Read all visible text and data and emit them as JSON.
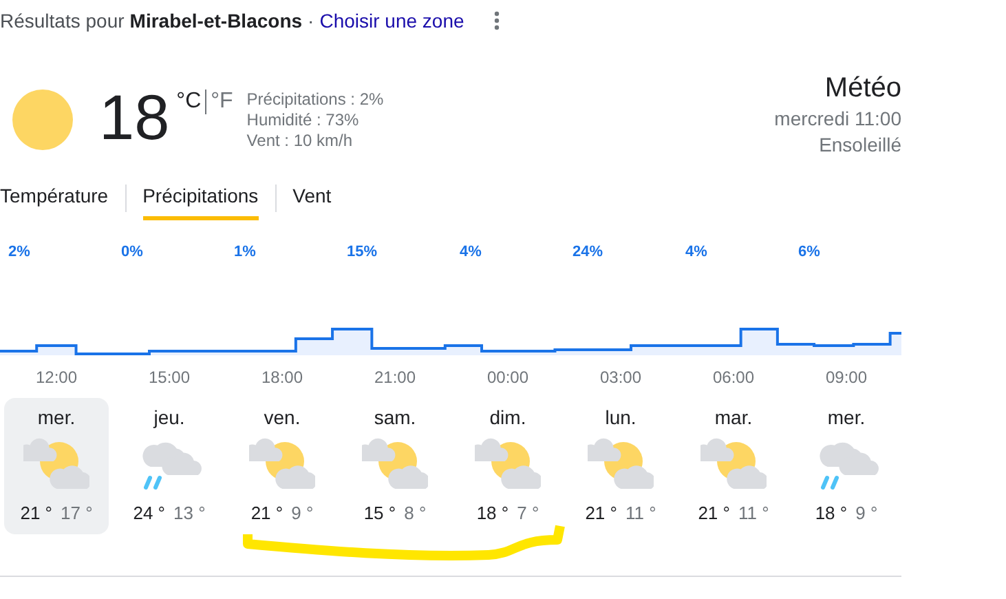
{
  "header": {
    "prefix": "Résultats pour",
    "location": "Mirabel-et-Blacons",
    "separator": "·",
    "change_link": "Choisir une zone"
  },
  "current": {
    "temperature": "18",
    "units": [
      {
        "label": "°C",
        "selected": true
      },
      {
        "label": "°F",
        "selected": false
      }
    ],
    "details": [
      "Précipitations : 2%",
      "Humidité : 73%",
      "Vent : 10 km/h"
    ]
  },
  "summary": {
    "title": "Météo",
    "time": "mercredi 11:00",
    "condition": "Ensoleillé"
  },
  "tabs": [
    {
      "label": "Température",
      "selected": false
    },
    {
      "label": "Précipitations",
      "selected": true
    },
    {
      "label": "Vent",
      "selected": false
    }
  ],
  "precipitation_labels": [
    "2%",
    "0%",
    "1%",
    "15%",
    "4%",
    "24%",
    "4%",
    "6%"
  ],
  "hours": [
    "12:00",
    "15:00",
    "18:00",
    "21:00",
    "00:00",
    "03:00",
    "06:00",
    "09:00"
  ],
  "days": [
    {
      "day": "mer.",
      "kind": "partly_cloudy",
      "high": "21 °",
      "low": "17 °",
      "selected": true
    },
    {
      "day": "jeu.",
      "kind": "rain",
      "high": "24 °",
      "low": "13 °",
      "selected": false
    },
    {
      "day": "ven.",
      "kind": "partly_cloudy",
      "high": "21 °",
      "low": "9 °",
      "selected": false
    },
    {
      "day": "sam.",
      "kind": "partly_cloudy",
      "high": "15 °",
      "low": "8 °",
      "selected": false
    },
    {
      "day": "dim.",
      "kind": "partly_cloudy",
      "high": "18 °",
      "low": "7 °",
      "selected": false
    },
    {
      "day": "lun.",
      "kind": "partly_cloudy",
      "high": "21 °",
      "low": "11 °",
      "selected": false
    },
    {
      "day": "mar.",
      "kind": "partly_cloudy",
      "high": "21 °",
      "low": "11 °",
      "selected": false
    },
    {
      "day": "mer.",
      "kind": "rain",
      "high": "18 °",
      "low": "9 °",
      "selected": false
    }
  ]
}
